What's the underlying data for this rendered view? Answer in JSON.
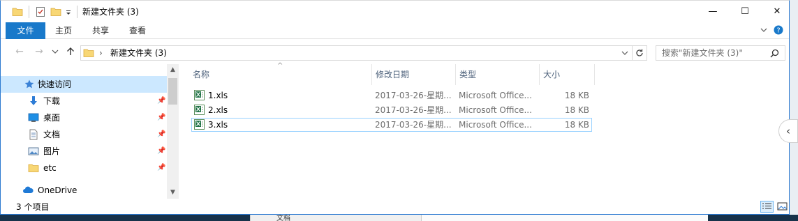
{
  "window": {
    "title": "新建文件夹 (3)",
    "controls": {
      "minimize": "—",
      "maximize": "☐",
      "close": "✕"
    }
  },
  "ribbon": {
    "tabs": [
      "文件",
      "主页",
      "共享",
      "查看"
    ],
    "active_tab": "文件",
    "accent": "#1979ca"
  },
  "address": {
    "breadcrumb_sep": "›",
    "path": "新建文件夹 (3)",
    "search_placeholder": "搜索\"新建文件夹 (3)\""
  },
  "nav": {
    "items": [
      {
        "label": "快速访问",
        "icon": "star-icon",
        "pinned": false,
        "selected": true
      },
      {
        "label": "下载",
        "icon": "download-icon",
        "pinned": true
      },
      {
        "label": "桌面",
        "icon": "desktop-icon",
        "pinned": true
      },
      {
        "label": "文档",
        "icon": "document-icon",
        "pinned": true
      },
      {
        "label": "图片",
        "icon": "picture-icon",
        "pinned": true
      },
      {
        "label": "etc",
        "icon": "folder-icon",
        "pinned": true
      },
      {
        "label": "OneDrive",
        "icon": "cloud-icon",
        "pinned": false
      }
    ]
  },
  "files": {
    "columns": [
      "名称",
      "修改日期",
      "类型",
      "大小"
    ],
    "sort_indicator": "^",
    "rows": [
      {
        "name": "1.xls",
        "date": "2017-03-26-星期...",
        "type": "Microsoft Office...",
        "size": "18 KB"
      },
      {
        "name": "2.xls",
        "date": "2017-03-26-星期...",
        "type": "Microsoft Office...",
        "size": "18 KB"
      },
      {
        "name": "3.xls",
        "date": "2017-03-26-星期...",
        "type": "Microsoft Office...",
        "size": "18 KB"
      }
    ]
  },
  "status": {
    "text": "3 个项目"
  },
  "background_peek": {
    "text": "文档"
  }
}
